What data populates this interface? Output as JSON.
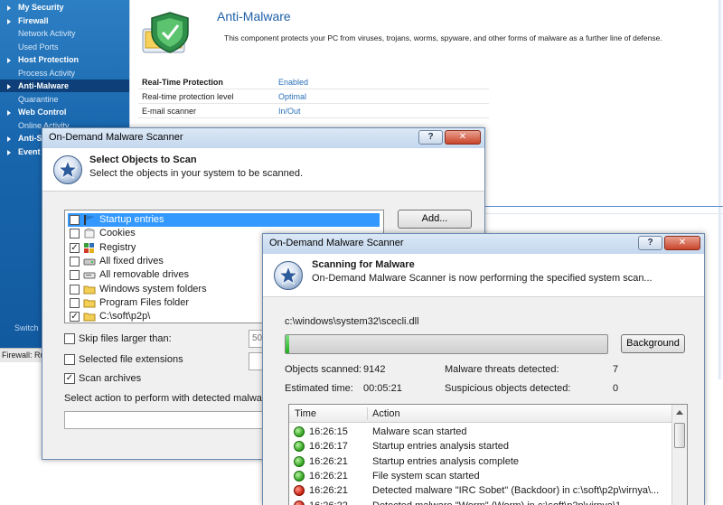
{
  "sidebar": {
    "items": [
      {
        "label": "My Security",
        "kind": "head"
      },
      {
        "label": "Firewall",
        "kind": "head"
      },
      {
        "label": "Network Activity",
        "kind": "sub"
      },
      {
        "label": "Used Ports",
        "kind": "sub"
      },
      {
        "label": "Host Protection",
        "kind": "head"
      },
      {
        "label": "Process Activity",
        "kind": "sub"
      },
      {
        "label": "Anti-Malware",
        "kind": "head",
        "selected": true
      },
      {
        "label": "Quarantine",
        "kind": "sub"
      },
      {
        "label": "Web Control",
        "kind": "head"
      },
      {
        "label": "Online Activity",
        "kind": "sub"
      },
      {
        "label": "Anti-S",
        "kind": "head"
      },
      {
        "label": "Event",
        "kind": "head"
      }
    ],
    "switch_label": "Switch"
  },
  "statusbar": {
    "text": "Firewall: Rul"
  },
  "main": {
    "title": "Anti-Malware",
    "description": "This component protects your PC from viruses, trojans, worms, spyware, and other forms of malware as a further line of defense.",
    "rows": [
      {
        "key": "Real-Time Protection",
        "value": "Enabled",
        "bold": true
      },
      {
        "key": "Real-time protection level",
        "value": "Optimal"
      },
      {
        "key": "E-mail scanner",
        "value": "In/Out"
      }
    ]
  },
  "select_dialog": {
    "title": "On-Demand Malware Scanner",
    "header_title": "Select Objects to Scan",
    "header_subtitle": "Select the objects in your system to be scanned.",
    "add_label": "Add...",
    "objects": [
      {
        "label": "Startup entries",
        "checked": true,
        "selected": true,
        "icon": "flag-icon"
      },
      {
        "label": "Cookies",
        "checked": false,
        "icon": "cookie-icon"
      },
      {
        "label": "Registry",
        "checked": true,
        "icon": "registry-icon"
      },
      {
        "label": "All fixed drives",
        "checked": false,
        "icon": "drive-icon"
      },
      {
        "label": "All removable drives",
        "checked": false,
        "icon": "removable-drive-icon"
      },
      {
        "label": "Windows system folders",
        "checked": false,
        "icon": "folder-icon"
      },
      {
        "label": "Program Files folder",
        "checked": false,
        "icon": "folder-icon"
      },
      {
        "label": "C:\\soft\\p2p\\",
        "checked": true,
        "icon": "folder-icon"
      }
    ],
    "options": [
      {
        "label": "Skip files larger than:",
        "checked": false
      },
      {
        "label": "Selected file extensions",
        "checked": false
      },
      {
        "label": "Scan archives",
        "checked": true
      }
    ],
    "size_value": "50",
    "action_text": "Select action to perform with detected malware"
  },
  "scan_dialog": {
    "title": "On-Demand Malware Scanner",
    "header_title": "Scanning for Malware",
    "header_subtitle": "On-Demand Malware Scanner is now performing the specified system scan...",
    "current_path": "c:\\windows\\system32\\scecli.dll",
    "progress_percent": 1,
    "background_label": "Background",
    "stats": {
      "objects_label": "Objects scanned:",
      "objects_value": "9142",
      "time_label": "Estimated time:",
      "time_value": "00:05:21",
      "threats_label": "Malware threats detected:",
      "threats_value": "7",
      "suspicious_label": "Suspicious objects detected:",
      "suspicious_value": "0"
    },
    "log": {
      "col_time": "Time",
      "col_action": "Action",
      "rows": [
        {
          "time": "16:26:15",
          "action": "Malware scan started",
          "status": "ok"
        },
        {
          "time": "16:26:17",
          "action": "Startup entries analysis started",
          "status": "ok"
        },
        {
          "time": "16:26:21",
          "action": "Startup entries analysis complete",
          "status": "ok"
        },
        {
          "time": "16:26:21",
          "action": "File system scan started",
          "status": "ok"
        },
        {
          "time": "16:26:21",
          "action": "Detected malware \"IRC Sobet\" (Backdoor) in c:\\soft\\p2p\\virnya\\...",
          "status": "bad"
        },
        {
          "time": "16:26:22",
          "action": "Detected malware \"Worm\" (Worm) in c:\\soft\\p2p\\virnya\\1...",
          "status": "bad"
        }
      ]
    }
  }
}
